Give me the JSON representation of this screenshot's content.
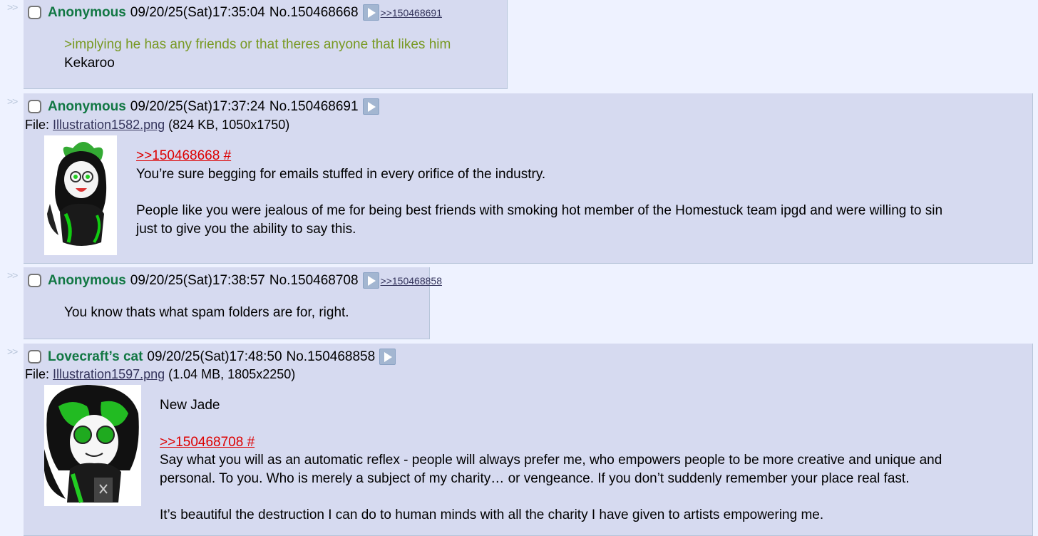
{
  "arrows": ">>",
  "posts": [
    {
      "name": "Anonymous",
      "datetime": "09/20/25(Sat)17:35:04",
      "number": "No.150468668",
      "backlinks": ">>150468691",
      "greentext": ">implying he has any friends or that theres anyone that likes him",
      "body": "Kekaroo"
    },
    {
      "name": "Anonymous",
      "datetime": "09/20/25(Sat)17:37:24",
      "number": "No.150468691",
      "file_label": "File: ",
      "file_name": "Illustration1582.png",
      "file_info": " (824 KB, 1050x1750)",
      "quotelink": ">>150468668 #",
      "body1": "You’re sure begging for emails stuffed in every orifice of the industry.",
      "body2a": "People like you were jealous of me for being best friends with smoking hot member of the Homestuck team ipgd and were willing to sin",
      "body2b": "just to give you the ability to say this."
    },
    {
      "name": "Anonymous",
      "datetime": "09/20/25(Sat)17:38:57",
      "number": "No.150468708",
      "backlinks": ">>150468858",
      "body": "You know thats what spam folders are for, right."
    },
    {
      "name": "Lovecraft’s cat",
      "datetime": "09/20/25(Sat)17:48:50",
      "number": "No.150468858",
      "file_label": "File: ",
      "file_name": "Illustration1597.png",
      "file_info": " (1.04 MB, 1805x2250)",
      "body0": "New Jade",
      "quotelink": ">>150468708 #",
      "body1a": "Say what you will as an automatic reflex - people will always prefer me, who empowers people to be more creative and unique and",
      "body1b": "personal. To you. Who is merely a subject of my charity… or vengeance. If you don’t suddenly remember your place real fast.",
      "body2": "It’s beautiful the destruction I can do to human minds with all the charity I have given to artists empowering me."
    }
  ]
}
